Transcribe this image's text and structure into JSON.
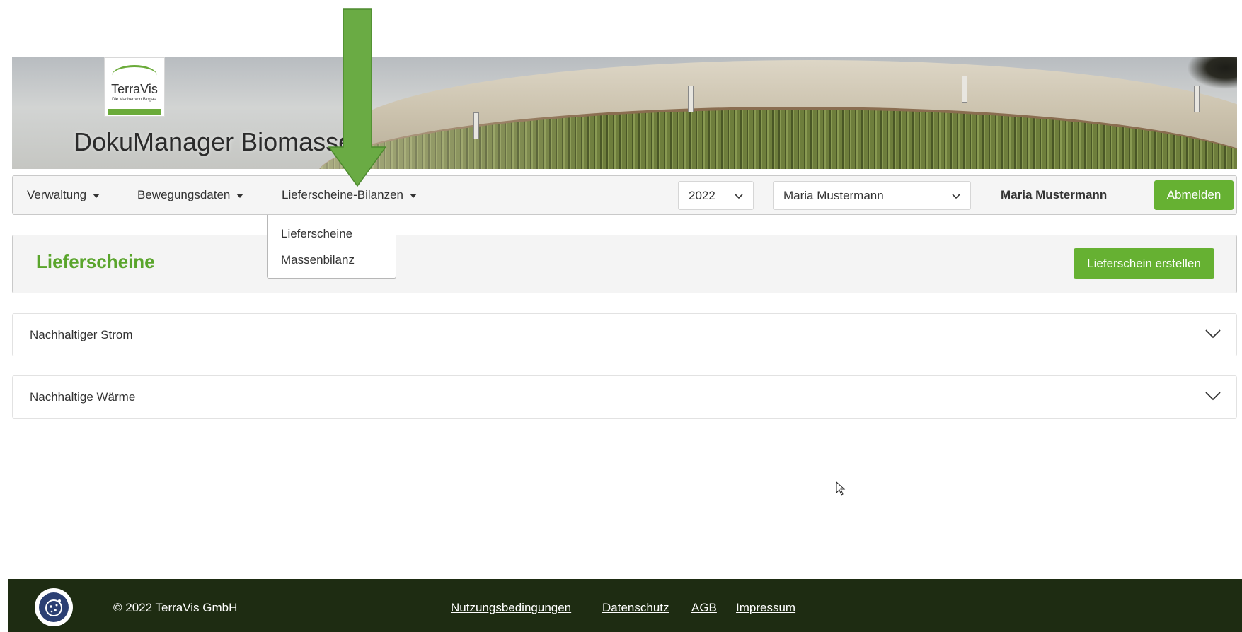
{
  "header": {
    "logo": {
      "brand": "TerraVis",
      "tagline": "Die Macher von Biogas."
    },
    "app_title": "DokuManager Biomasse"
  },
  "navbar": {
    "menus": [
      {
        "label": "Verwaltung"
      },
      {
        "label": "Bewegungsdaten"
      },
      {
        "label": "Lieferscheine-Bilanzen"
      }
    ],
    "year_select": {
      "value": "2022"
    },
    "user_select": {
      "value": "Maria Mustermann"
    },
    "current_user": "Maria Mustermann",
    "logout_label": "Abmelden"
  },
  "dropdown": {
    "items": [
      {
        "label": "Lieferscheine"
      },
      {
        "label": "Massenbilanz"
      }
    ]
  },
  "page": {
    "title": "Lieferscheine",
    "create_button": "Lieferschein erstellen"
  },
  "accordions": [
    {
      "label": "Nachhaltiger Strom"
    },
    {
      "label": "Nachhaltige Wärme"
    }
  ],
  "footer": {
    "copyright": "© 2022 TerraVis GmbH",
    "links": [
      {
        "label": "Nutzungsbedingungen"
      },
      {
        "label": "Datenschutz"
      },
      {
        "label": "AGB"
      },
      {
        "label": "Impressum"
      }
    ]
  },
  "colors": {
    "accent_green": "#66b132",
    "title_green": "#5aa52c",
    "footer_bg": "#1e2c12",
    "arrow_green": "#6aab44"
  }
}
